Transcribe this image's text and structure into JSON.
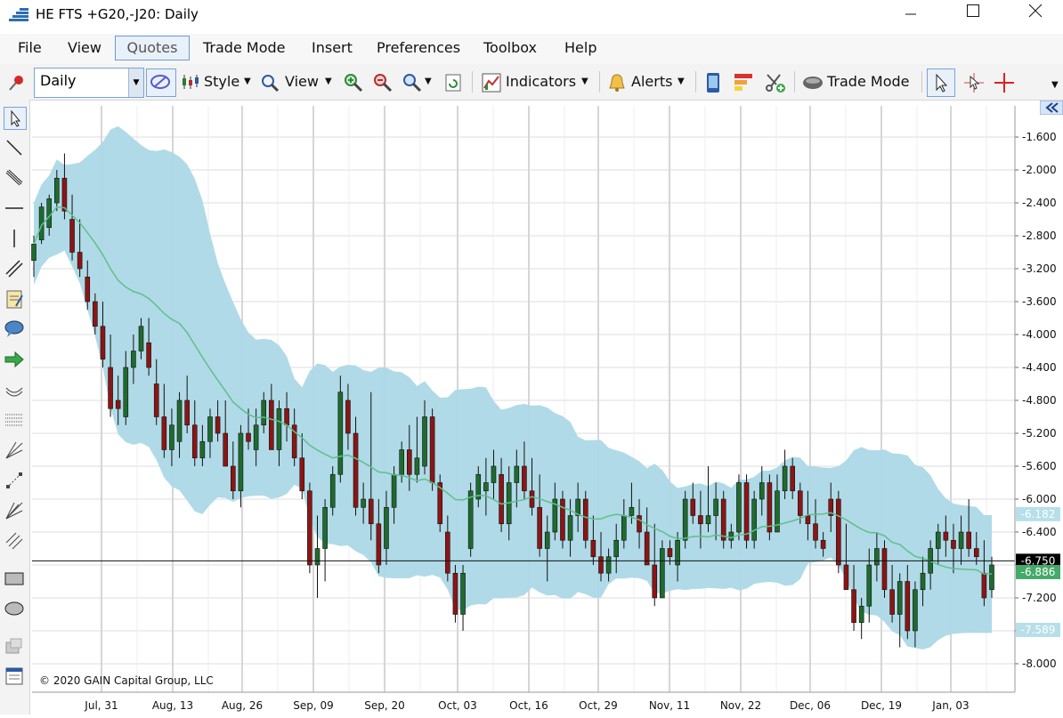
{
  "window": {
    "title": "HE FTS +G20,-J20: Daily"
  },
  "menu": [
    "File",
    "View",
    "Quotes",
    "Trade Mode",
    "Insert",
    "Preferences",
    "Toolbox",
    "Help"
  ],
  "toolbar": {
    "period_value": "Daily",
    "style_label": "Style",
    "view_label": "View",
    "indicators_label": "Indicators",
    "alerts_label": "Alerts",
    "trade_mode_label": "Trade Mode"
  },
  "copyright": "© 2020 GAIN Capital Group, LLC",
  "chart_data": {
    "type": "candlestick",
    "y_ticks": [
      "-1.600",
      "-2.000",
      "-2.400",
      "-2.800",
      "-3.200",
      "-3.600",
      "-4.000",
      "-4.400",
      "-4.800",
      "-5.200",
      "-5.600",
      "-6.000",
      "-6.400",
      "-6.800",
      "-7.200",
      "-7.600",
      "-8.000"
    ],
    "y_tick_values": [
      -1.6,
      -2.0,
      -2.4,
      -2.8,
      -3.2,
      -3.6,
      -4.0,
      -4.4,
      -4.8,
      -5.2,
      -5.6,
      -6.0,
      -6.4,
      -6.8,
      -7.2,
      -7.6,
      -8.0
    ],
    "x_labels": [
      "Jul, 31",
      "Aug, 13",
      "Aug, 26",
      "Sep, 09",
      "Sep, 20",
      "Oct, 03",
      "Oct, 16",
      "Oct, 29",
      "Nov, 11",
      "Nov, 22",
      "Dec, 06",
      "Dec, 19",
      "Jan, 03"
    ],
    "ylim": [
      -8.3,
      -1.3
    ],
    "grid": true,
    "price_labels": [
      {
        "text": "-6.182",
        "value": -6.182,
        "color": "#b6dfe9",
        "text_color": "#ffffff"
      },
      {
        "text": "-6.750",
        "value": -6.75,
        "color": "#000000",
        "text_color": "#ffffff"
      },
      {
        "text": "-6.886",
        "value": -6.886,
        "color": "#45a96a",
        "text_color": "#ffffff"
      },
      {
        "text": "-7.589",
        "value": -7.589,
        "color": "#b6dfe9",
        "text_color": "#ffffff"
      }
    ],
    "horizontal_line": -6.75,
    "candles": [
      {
        "o": -3.1,
        "h": -2.8,
        "l": -3.3,
        "c": -2.9
      },
      {
        "o": -2.85,
        "h": -2.4,
        "l": -2.9,
        "c": -2.45
      },
      {
        "o": -2.7,
        "h": -2.3,
        "l": -2.8,
        "c": -2.35
      },
      {
        "o": -2.4,
        "h": -2.0,
        "l": -2.5,
        "c": -2.1
      },
      {
        "o": -2.1,
        "h": -1.8,
        "l": -2.6,
        "c": -2.5
      },
      {
        "o": -2.6,
        "h": -2.3,
        "l": -3.1,
        "c": -3.0
      },
      {
        "o": -3.0,
        "h": -2.6,
        "l": -3.3,
        "c": -3.2
      },
      {
        "o": -3.3,
        "h": -3.1,
        "l": -3.7,
        "c": -3.6
      },
      {
        "o": -3.6,
        "h": -3.5,
        "l": -4.0,
        "c": -3.9
      },
      {
        "o": -3.9,
        "h": -3.6,
        "l": -4.4,
        "c": -4.3
      },
      {
        "o": -4.4,
        "h": -4.0,
        "l": -5.0,
        "c": -4.9
      },
      {
        "o": -4.8,
        "h": -4.5,
        "l": -5.1,
        "c": -4.9
      },
      {
        "o": -5.0,
        "h": -4.2,
        "l": -5.1,
        "c": -4.4
      },
      {
        "o": -4.4,
        "h": -4.0,
        "l": -4.6,
        "c": -4.2
      },
      {
        "o": -4.2,
        "h": -3.8,
        "l": -4.3,
        "c": -3.9
      },
      {
        "o": -4.1,
        "h": -3.8,
        "l": -4.5,
        "c": -4.4
      },
      {
        "o": -4.6,
        "h": -4.3,
        "l": -5.1,
        "c": -5.0
      },
      {
        "o": -5.0,
        "h": -4.6,
        "l": -5.5,
        "c": -5.4
      },
      {
        "o": -5.4,
        "h": -4.9,
        "l": -5.6,
        "c": -5.1
      },
      {
        "o": -5.3,
        "h": -4.7,
        "l": -5.5,
        "c": -4.8
      },
      {
        "o": -4.8,
        "h": -4.5,
        "l": -5.2,
        "c": -5.1
      },
      {
        "o": -5.1,
        "h": -4.8,
        "l": -5.6,
        "c": -5.5
      },
      {
        "o": -5.5,
        "h": -5.1,
        "l": -5.6,
        "c": -5.3
      },
      {
        "o": -5.3,
        "h": -4.9,
        "l": -5.5,
        "c": -5.0
      },
      {
        "o": -5.0,
        "h": -4.8,
        "l": -5.3,
        "c": -5.2
      },
      {
        "o": -5.2,
        "h": -4.8,
        "l": -5.6,
        "c": -5.6
      },
      {
        "o": -5.6,
        "h": -5.3,
        "l": -6.0,
        "c": -5.9
      },
      {
        "o": -5.9,
        "h": -5.1,
        "l": -6.1,
        "c": -5.2
      },
      {
        "o": -5.2,
        "h": -4.9,
        "l": -5.4,
        "c": -5.3
      },
      {
        "o": -5.4,
        "h": -4.9,
        "l": -5.6,
        "c": -5.1
      },
      {
        "o": -5.1,
        "h": -4.7,
        "l": -5.2,
        "c": -4.8
      },
      {
        "o": -4.8,
        "h": -4.6,
        "l": -5.4,
        "c": -5.4
      },
      {
        "o": -5.4,
        "h": -4.8,
        "l": -5.6,
        "c": -4.9
      },
      {
        "o": -4.9,
        "h": -4.7,
        "l": -5.3,
        "c": -5.1
      },
      {
        "o": -5.1,
        "h": -4.9,
        "l": -5.6,
        "c": -5.5
      },
      {
        "o": -5.5,
        "h": -5.2,
        "l": -6.0,
        "c": -5.9
      },
      {
        "o": -5.9,
        "h": -5.8,
        "l": -6.9,
        "c": -6.8
      },
      {
        "o": -6.8,
        "h": -6.2,
        "l": -7.2,
        "c": -6.6
      },
      {
        "o": -6.6,
        "h": -6.0,
        "l": -7.0,
        "c": -6.1
      },
      {
        "o": -6.1,
        "h": -5.6,
        "l": -6.2,
        "c": -5.7
      },
      {
        "o": -5.7,
        "h": -4.5,
        "l": -5.8,
        "c": -4.7
      },
      {
        "o": -4.8,
        "h": -4.6,
        "l": -5.4,
        "c": -5.2
      },
      {
        "o": -5.2,
        "h": -5.0,
        "l": -6.2,
        "c": -6.1
      },
      {
        "o": -6.1,
        "h": -5.8,
        "l": -6.3,
        "c": -6.0
      },
      {
        "o": -6.0,
        "h": -4.7,
        "l": -6.5,
        "c": -6.3
      },
      {
        "o": -6.3,
        "h": -6.0,
        "l": -6.9,
        "c": -6.8
      },
      {
        "o": -6.6,
        "h": -5.9,
        "l": -6.8,
        "c": -6.1
      },
      {
        "o": -6.1,
        "h": -5.6,
        "l": -6.3,
        "c": -5.7
      },
      {
        "o": -5.7,
        "h": -5.3,
        "l": -5.8,
        "c": -5.4
      },
      {
        "o": -5.4,
        "h": -5.1,
        "l": -5.9,
        "c": -5.7
      },
      {
        "o": -5.7,
        "h": -5.0,
        "l": -5.8,
        "c": -5.5
      },
      {
        "o": -5.6,
        "h": -4.8,
        "l": -5.7,
        "c": -5.0
      },
      {
        "o": -5.0,
        "h": -4.9,
        "l": -5.9,
        "c": -5.8
      },
      {
        "o": -5.8,
        "h": -5.7,
        "l": -6.4,
        "c": -6.3
      },
      {
        "o": -6.4,
        "h": -6.2,
        "l": -7.0,
        "c": -6.9
      },
      {
        "o": -6.9,
        "h": -6.8,
        "l": -7.5,
        "c": -7.4
      },
      {
        "o": -7.4,
        "h": -6.8,
        "l": -7.6,
        "c": -6.9
      },
      {
        "o": -6.6,
        "h": -5.8,
        "l": -6.7,
        "c": -5.9
      },
      {
        "o": -6.0,
        "h": -5.6,
        "l": -6.1,
        "c": -5.7
      },
      {
        "o": -5.9,
        "h": -5.5,
        "l": -6.2,
        "c": -5.8
      },
      {
        "o": -5.8,
        "h": -5.4,
        "l": -6.0,
        "c": -5.6
      },
      {
        "o": -5.7,
        "h": -5.5,
        "l": -6.4,
        "c": -6.3
      },
      {
        "o": -6.3,
        "h": -5.6,
        "l": -6.5,
        "c": -5.8
      },
      {
        "o": -5.8,
        "h": -5.4,
        "l": -6.1,
        "c": -5.6
      },
      {
        "o": -5.6,
        "h": -5.3,
        "l": -6.0,
        "c": -5.9
      },
      {
        "o": -5.9,
        "h": -5.5,
        "l": -6.2,
        "c": -6.1
      },
      {
        "o": -6.1,
        "h": -5.7,
        "l": -6.7,
        "c": -6.6
      },
      {
        "o": -6.6,
        "h": -6.2,
        "l": -7.0,
        "c": -6.4
      },
      {
        "o": -6.4,
        "h": -5.8,
        "l": -6.5,
        "c": -6.0
      },
      {
        "o": -6.0,
        "h": -5.9,
        "l": -6.6,
        "c": -6.5
      },
      {
        "o": -6.5,
        "h": -6.0,
        "l": -6.7,
        "c": -6.2
      },
      {
        "o": -6.2,
        "h": -5.8,
        "l": -6.4,
        "c": -6.0
      },
      {
        "o": -6.0,
        "h": -5.9,
        "l": -6.6,
        "c": -6.5
      },
      {
        "o": -6.5,
        "h": -6.2,
        "l": -6.8,
        "c": -6.7
      },
      {
        "o": -6.7,
        "h": -6.4,
        "l": -7.0,
        "c": -6.9
      },
      {
        "o": -6.9,
        "h": -6.6,
        "l": -7.0,
        "c": -6.7
      },
      {
        "o": -6.7,
        "h": -6.3,
        "l": -6.9,
        "c": -6.5
      },
      {
        "o": -6.5,
        "h": -6.0,
        "l": -6.6,
        "c": -6.2
      },
      {
        "o": -6.2,
        "h": -5.8,
        "l": -6.3,
        "c": -6.1
      },
      {
        "o": -6.2,
        "h": -6.0,
        "l": -6.6,
        "c": -6.4
      },
      {
        "o": -6.4,
        "h": -6.1,
        "l": -6.8,
        "c": -6.8
      },
      {
        "o": -6.8,
        "h": -6.3,
        "l": -7.3,
        "c": -7.2
      },
      {
        "o": -7.2,
        "h": -6.5,
        "l": -7.2,
        "c": -6.6
      },
      {
        "o": -6.6,
        "h": -6.5,
        "l": -6.8,
        "c": -6.7
      },
      {
        "o": -6.8,
        "h": -6.4,
        "l": -7.0,
        "c": -6.5
      },
      {
        "o": -6.5,
        "h": -5.9,
        "l": -6.6,
        "c": -6.0
      },
      {
        "o": -6.0,
        "h": -5.8,
        "l": -6.3,
        "c": -6.2
      },
      {
        "o": -6.2,
        "h": -5.9,
        "l": -6.6,
        "c": -6.3
      },
      {
        "o": -6.3,
        "h": -5.6,
        "l": -6.4,
        "c": -6.2
      },
      {
        "o": -6.2,
        "h": -5.8,
        "l": -6.5,
        "c": -6.0
      },
      {
        "o": -6.0,
        "h": -5.9,
        "l": -6.6,
        "c": -6.5
      },
      {
        "o": -6.5,
        "h": -6.3,
        "l": -6.6,
        "c": -6.4
      },
      {
        "o": -6.4,
        "h": -5.7,
        "l": -6.5,
        "c": -5.8
      },
      {
        "o": -5.8,
        "h": -5.7,
        "l": -6.6,
        "c": -6.5
      },
      {
        "o": -6.5,
        "h": -5.9,
        "l": -6.6,
        "c": -6.0
      },
      {
        "o": -6.0,
        "h": -5.6,
        "l": -6.2,
        "c": -5.8
      },
      {
        "o": -5.8,
        "h": -5.7,
        "l": -6.5,
        "c": -6.4
      },
      {
        "o": -6.4,
        "h": -5.7,
        "l": -6.4,
        "c": -5.9
      },
      {
        "o": -5.9,
        "h": -5.4,
        "l": -6.0,
        "c": -5.6
      },
      {
        "o": -5.6,
        "h": -5.5,
        "l": -6.0,
        "c": -5.9
      },
      {
        "o": -5.9,
        "h": -5.8,
        "l": -6.3,
        "c": -6.2
      },
      {
        "o": -6.2,
        "h": -5.9,
        "l": -6.5,
        "c": -6.3
      },
      {
        "o": -6.3,
        "h": -6.0,
        "l": -6.6,
        "c": -6.5
      },
      {
        "o": -6.5,
        "h": -6.4,
        "l": -6.7,
        "c": -6.6
      },
      {
        "o": -6.0,
        "h": -5.8,
        "l": -6.4,
        "c": -6.2
      },
      {
        "o": -6.0,
        "h": -5.9,
        "l": -6.9,
        "c": -6.8
      },
      {
        "o": -6.8,
        "h": -6.3,
        "l": -7.1,
        "c": -7.1
      },
      {
        "o": -7.1,
        "h": -6.8,
        "l": -7.6,
        "c": -7.5
      },
      {
        "o": -7.5,
        "h": -7.2,
        "l": -7.7,
        "c": -7.3
      },
      {
        "o": -7.3,
        "h": -6.6,
        "l": -7.5,
        "c": -6.8
      },
      {
        "o": -6.8,
        "h": -6.4,
        "l": -7.0,
        "c": -6.6
      },
      {
        "o": -6.6,
        "h": -6.5,
        "l": -7.2,
        "c": -7.1
      },
      {
        "o": -7.1,
        "h": -6.8,
        "l": -7.5,
        "c": -7.4
      },
      {
        "o": -7.4,
        "h": -6.9,
        "l": -7.8,
        "c": -7.0
      },
      {
        "o": -7.0,
        "h": -6.8,
        "l": -7.7,
        "c": -7.6
      },
      {
        "o": -7.6,
        "h": -7.0,
        "l": -7.8,
        "c": -7.1
      },
      {
        "o": -7.1,
        "h": -6.7,
        "l": -7.3,
        "c": -6.9
      },
      {
        "o": -6.9,
        "h": -6.5,
        "l": -7.1,
        "c": -6.6
      },
      {
        "o": -6.6,
        "h": -6.3,
        "l": -6.8,
        "c": -6.4
      },
      {
        "o": -6.4,
        "h": -6.2,
        "l": -6.7,
        "c": -6.5
      },
      {
        "o": -6.5,
        "h": -6.3,
        "l": -6.9,
        "c": -6.6
      },
      {
        "o": -6.6,
        "h": -6.2,
        "l": -6.8,
        "c": -6.4
      },
      {
        "o": -6.4,
        "h": -6.0,
        "l": -6.7,
        "c": -6.6
      },
      {
        "o": -6.6,
        "h": -6.4,
        "l": -6.8,
        "c": -6.7
      },
      {
        "o": -6.9,
        "h": -6.5,
        "l": -7.3,
        "c": -7.2
      },
      {
        "o": -7.1,
        "h": -6.7,
        "l": -7.2,
        "c": -6.8
      }
    ]
  }
}
